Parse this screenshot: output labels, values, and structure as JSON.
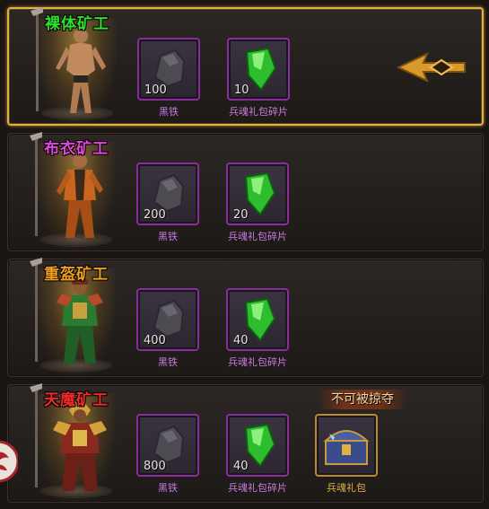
{
  "miners": [
    {
      "title": "裸体矿工",
      "title_color": "#2fe02f",
      "selected": true,
      "items": [
        {
          "name": "黑铁",
          "qty": "100",
          "icon": "black-iron-ore-icon"
        },
        {
          "name": "兵魂礼包碎片",
          "qty": "10",
          "icon": "green-crystal-fragment-icon"
        }
      ]
    },
    {
      "title": "布衣矿工",
      "title_color": "#e045e0",
      "selected": false,
      "items": [
        {
          "name": "黑铁",
          "qty": "200",
          "icon": "black-iron-ore-icon"
        },
        {
          "name": "兵魂礼包碎片",
          "qty": "20",
          "icon": "green-crystal-fragment-icon"
        }
      ]
    },
    {
      "title": "重盔矿工",
      "title_color": "#f0a020",
      "selected": false,
      "items": [
        {
          "name": "黑铁",
          "qty": "400",
          "icon": "black-iron-ore-icon"
        },
        {
          "name": "兵魂礼包碎片",
          "qty": "40",
          "icon": "green-crystal-fragment-icon"
        }
      ]
    },
    {
      "title": "天魔矿工",
      "title_color": "#f02a2a",
      "selected": false,
      "items": [
        {
          "name": "黑铁",
          "qty": "800",
          "icon": "black-iron-ore-icon"
        },
        {
          "name": "兵魂礼包碎片",
          "qty": "40",
          "icon": "green-crystal-fragment-icon"
        },
        {
          "name": "兵魂礼包",
          "qty": "",
          "icon": "treasure-chest-icon"
        }
      ],
      "badge": "不可被掠夺"
    }
  ],
  "colors": {
    "selected_border": "#e0b245",
    "purple_frame": "#8a2d9a",
    "gold_frame": "#b98a2e"
  }
}
